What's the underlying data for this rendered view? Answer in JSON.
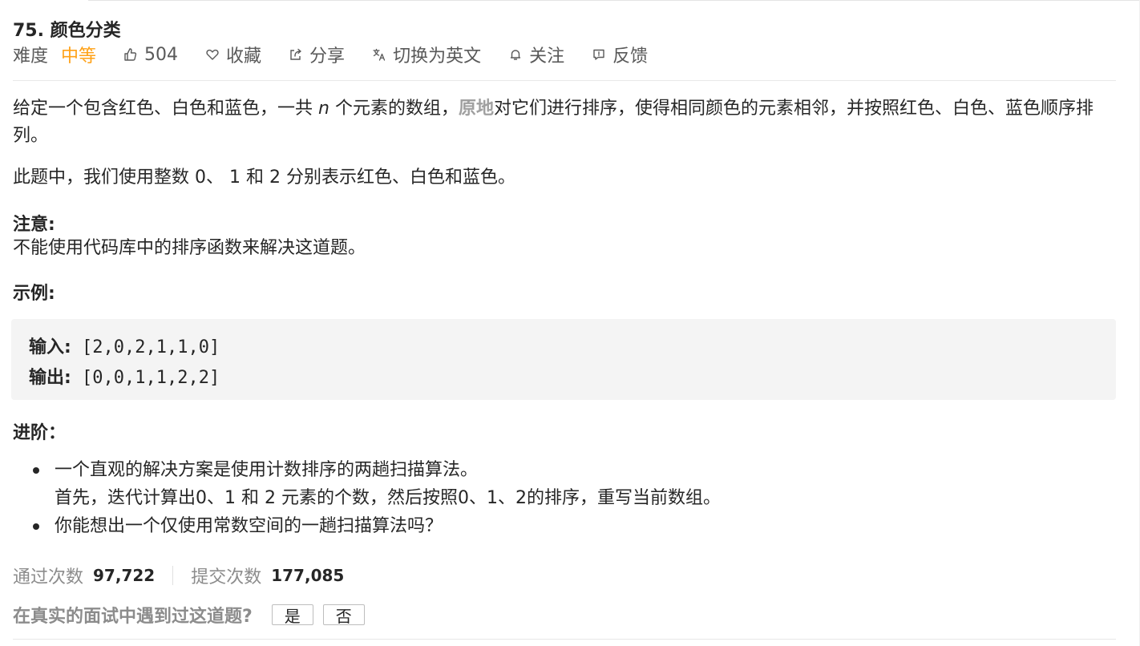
{
  "problem": {
    "title": "75. 颜色分类",
    "difficulty_label": "难度",
    "difficulty_value": "中等",
    "likes": "504",
    "favorite_label": "收藏",
    "share_label": "分享",
    "switch_lang_label": "切换为英文",
    "follow_label": "关注",
    "feedback_label": "反馈"
  },
  "description": {
    "p1_part1": "给定一个包含红色、白色和蓝色，一共 ",
    "p1_var": "n",
    "p1_part2": " 个元素的数组，",
    "p1_highlight": "原地",
    "p1_part3": "对它们进行排序，使得相同颜色的元素相邻，并按照红色、白色、蓝色顺序排列。",
    "p2": "此题中，我们使用整数 0、 1 和 2 分别表示红色、白色和蓝色。",
    "note_heading": "注意:",
    "note_text": "不能使用代码库中的排序函数来解决这道题。",
    "example_heading": "示例:",
    "example_input_label": "输入:",
    "example_input_value": " [2,0,2,1,1,0]",
    "example_output_label": "输出:",
    "example_output_value": " [0,0,1,1,2,2]",
    "advanced_heading": "进阶：",
    "bullet1_line1": "一个直观的解决方案是使用计数排序的两趟扫描算法。",
    "bullet1_line2": "首先，迭代计算出0、1 和 2 元素的个数，然后按照0、1、2的排序，重写当前数组。",
    "bullet2": "你能想出一个仅使用常数空间的一趟扫描算法吗？"
  },
  "stats": {
    "accepted_label": "通过次数",
    "accepted_value": "97,722",
    "submissions_label": "提交次数",
    "submissions_value": "177,085"
  },
  "interview": {
    "question": "在真实的面试中遇到过这道题?",
    "yes_label": "是",
    "no_label": "否"
  },
  "colors": {
    "difficulty_medium": "#ffa116",
    "text_primary": "#262626",
    "text_muted": "#8c8c8c",
    "code_bg": "#f4f4f4"
  }
}
